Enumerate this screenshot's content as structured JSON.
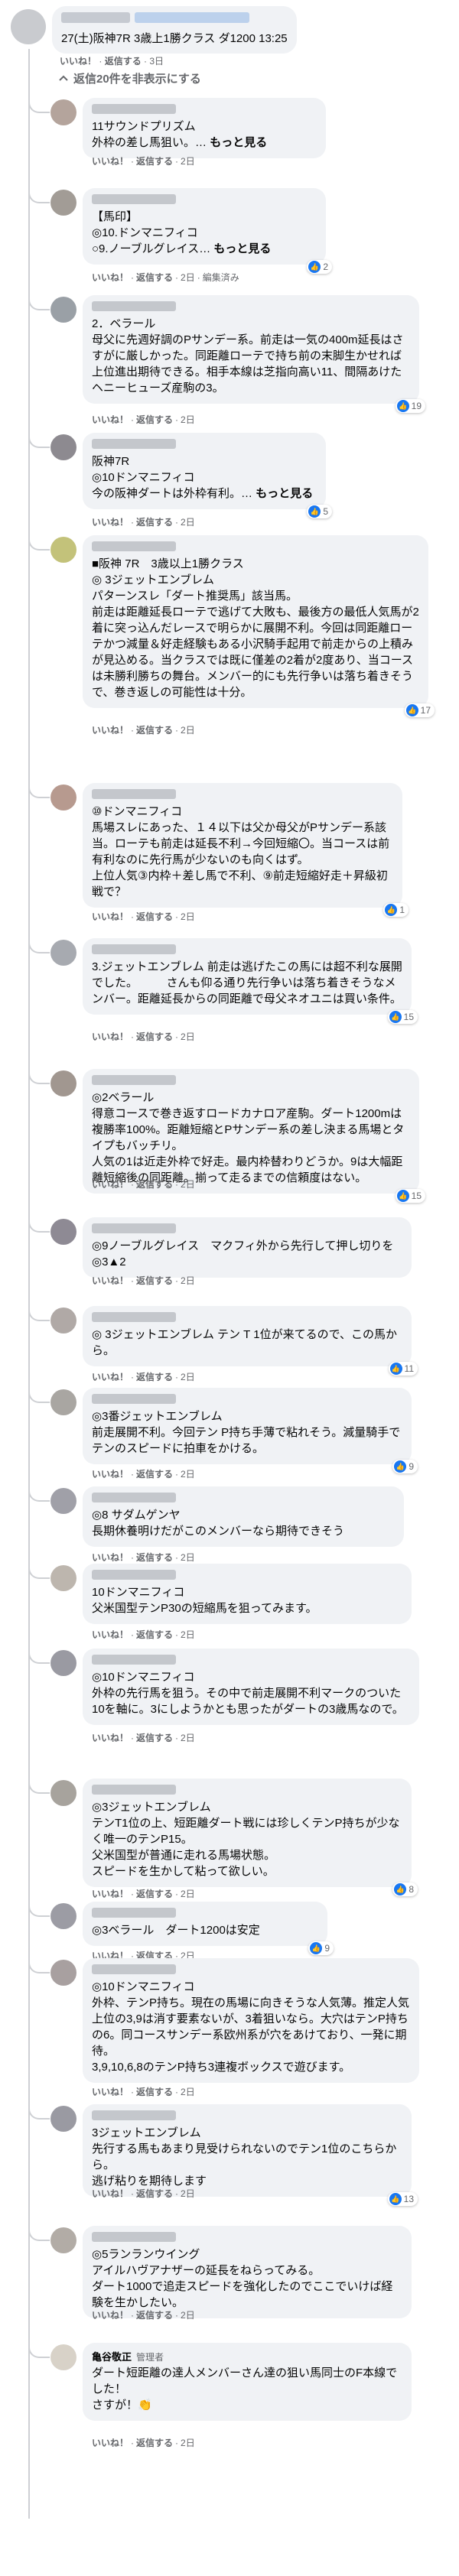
{
  "root": {
    "text": "27(土)阪神7R 3歳上1勝クラス ダ1200 13:25",
    "meta": {
      "like": "いいね！",
      "reply": "返信する",
      "time": "3日"
    }
  },
  "toggle": {
    "label": "返信20件を非表示にする"
  },
  "colors": {
    "link_blue": "#1877f2",
    "bubble_bg": "#f0f2f5",
    "meta_gray": "#65676b"
  },
  "replies": [
    {
      "body": "11サウンドプリズム\n外枠の差し馬狙い。…",
      "more": "もっと見る",
      "meta": [
        "いいね！",
        "返信する",
        "2日"
      ],
      "react": ""
    },
    {
      "body": "【馬印】\n◎10.ドンマニフィコ\n○9.ノーブルグレイス…",
      "more": "もっと見る",
      "meta": [
        "いいね！",
        "返信する",
        "2日",
        "編集済み"
      ],
      "react": "2"
    },
    {
      "body": "2．ベラール\n母父に先週好調のPサンデー系。前走は一気の400m延長はさすがに厳しかった。同距離ローテで持ち前の末脚生かせれば上位進出期待できる。相手本線は芝指向高い11、間隔あけたヘニーヒューズ産駒の3。",
      "more": "",
      "meta": [
        "いいね！",
        "返信する",
        "2日"
      ],
      "react": "19"
    },
    {
      "body": "阪神7R\n◎10ドンマニフィコ\n今の阪神ダートは外枠有利。…",
      "more": "もっと見る",
      "meta": [
        "いいね！",
        "返信する",
        "2日"
      ],
      "react": "5"
    },
    {
      "body": "■阪神 7R　3歳以上1勝クラス\n◎ 3ジェットエンブレム\nパターンスレ「ダート推奨馬」該当馬。\n前走は距離延長ローテで逃げて大敗も、最後方の最低人気馬が2着に突っ込んだレースで明らかに展開不利。今回は同距離ローテかつ減量＆好走経験もある小沢騎手起用で前走からの上積みが見込める。当クラスでは既に僅差の2着が2度あり、当コースは未勝利勝ちの舞台。メンバー的にも先行争いは落ち着きそうで、巻き返しの可能性は十分。",
      "more": "",
      "meta": [
        "いいね！",
        "返信する",
        "2日"
      ],
      "react": "17"
    },
    {
      "body": "⑩ドンマニフィコ\n馬場スレにあった、１４以下は父か母父がPサンデー系該当。ローテも前走は延長不利→今回短縮〇。当コースは前有利なのに先行馬が少ないのも向くはず。\n上位人気③内枠＋差し馬で不利、⑨前走短縮好走＋昇級初戦で？",
      "more": "",
      "meta": [
        "いいね！",
        "返信する",
        "2日"
      ],
      "react": "1"
    },
    {
      "body": "3.ジェットエンブレム 前走は逃げたこの馬には超不利な展開でした。　　　さんも仰る通り先行争いは落ち着きそうなメンバー。距離延長からの同距離で母父ネオユニは買い条件。",
      "more": "",
      "meta": [
        "いいね！",
        "返信する",
        "2日"
      ],
      "react": "15"
    },
    {
      "body": "◎2ベラール\n得意コースで巻き返すロードカナロア産駒。ダート1200mは複勝率100%。距離短縮とPサンデー系の差し決まる馬場とタイプもバッチリ。\n人気の1は近走外枠で好走。最内枠替わりどうか。9は大幅距離短縮後の同距離。揃って走るまでの信頼度はない。",
      "more": "",
      "meta": [
        "いいね！",
        "返信する",
        "2日"
      ],
      "react": "15"
    },
    {
      "body": "◎9ノーブルグレイス　マクフィ外から先行して押し切りを◎3▲2",
      "more": "",
      "meta": [
        "いいね！",
        "返信する",
        "2日"
      ],
      "react": ""
    },
    {
      "body": "◎ 3ジェットエンブレム テン T 1位が来てるので、この馬から。",
      "more": "",
      "meta": [
        "いいね！",
        "返信する",
        "2日"
      ],
      "react": "11"
    },
    {
      "body": "◎3番ジェットエンブレム\n前走展開不利。今回テン P持ち手薄で粘れそう。減量騎手でテンのスピードに拍車をかける。",
      "more": "",
      "meta": [
        "いいね！",
        "返信する",
        "2日"
      ],
      "react": "9"
    },
    {
      "body": "◎8 サダムゲンヤ\n長期休養明けだがこのメンバーなら期待できそう",
      "more": "",
      "meta": [
        "いいね！",
        "返信する",
        "2日"
      ],
      "react": ""
    },
    {
      "body": "10ドンマニフィコ\n父米国型テンP30の短縮馬を狙ってみます。",
      "more": "",
      "meta": [
        "いいね！",
        "返信する",
        "2日"
      ],
      "react": ""
    },
    {
      "body": "◎10ドンマニフィコ\n外枠の先行馬を狙う。その中で前走展開不利マークのついた10を軸に。3にしようかとも思ったがダートの3歳馬なので。",
      "more": "",
      "meta": [
        "いいね！",
        "返信する",
        "2日"
      ],
      "react": ""
    },
    {
      "body": "◎3ジェットエンブレム\nテンT1位の上、短距離ダート戦には珍しくテンP持ちが少なく唯一のテンP15。\n父米国型が普通に走れる馬場状態。\nスピードを生かして粘って欲しい。",
      "more": "",
      "meta": [
        "いいね！",
        "返信する",
        "2日"
      ],
      "react": "8"
    },
    {
      "body": "◎3ベラール　ダート1200は安定",
      "more": "",
      "meta": [
        "いいね！",
        "返信する",
        "2日"
      ],
      "react": "9"
    },
    {
      "body": "◎10ドンマニフィコ\n外枠、テンP持ち。現在の馬場に向きそうな人気薄。推定人気上位の3,9は消す要素ないが、3着狙いなら。大穴はテンP持ちの6。同コースサンデー系欧州系が穴をあけており、一発に期待。\n3,9,10,6,8のテンP持ち3連複ボックスで遊びます。",
      "more": "",
      "meta": [
        "いいね！",
        "返信する",
        "2日"
      ],
      "react": ""
    },
    {
      "body": "3ジェットエンブレム\n先行する馬もあまり見受けられないのでテン1位のこちらから。\n逃げ粘りを期待します",
      "more": "",
      "meta": [
        "いいね！",
        "返信する",
        "2日"
      ],
      "react": "13"
    },
    {
      "body": "◎5ランランウイング\nアイルハヴアナザーの延長をねらってみる。\nダート1000で追走スピードを強化したのでここでいけば経験を生かしたい。",
      "more": "",
      "meta": [
        "いいね！",
        "返信する",
        "2日"
      ],
      "react": ""
    },
    {
      "name": "亀谷敬正",
      "badge": "管理者",
      "body": "ダート短距離の達人メンバーさん達の狙い馬同士のF本線でした！\nさすが！👏",
      "more": "",
      "meta": [
        "いいね！",
        "返信する",
        "2日"
      ],
      "react": ""
    }
  ]
}
